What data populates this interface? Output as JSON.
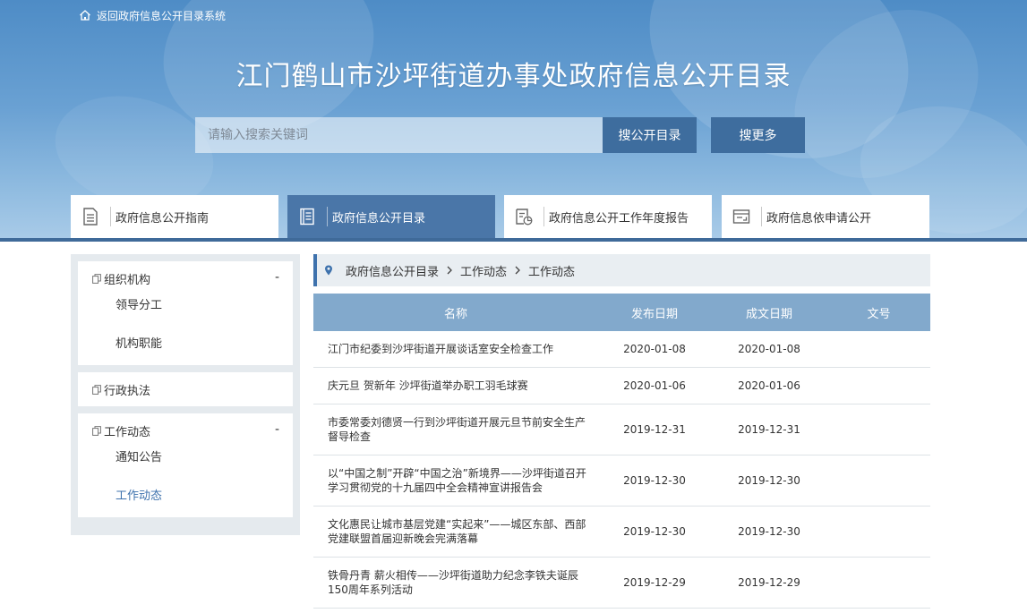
{
  "header": {
    "back_link": "返回政府信息公开目录系统",
    "title": "江门鹤山市沙坪街道办事处政府信息公开目录",
    "search_placeholder": "请输入搜索关键词",
    "search_catalog_button": "搜公开目录",
    "search_more_button": "搜更多"
  },
  "nav": {
    "tabs": [
      {
        "label": "政府信息公开指南",
        "icon": "document-lines-icon"
      },
      {
        "label": "政府信息公开目录",
        "icon": "catalog-book-icon",
        "active": true
      },
      {
        "label": "政府信息公开工作年度报告",
        "icon": "report-chart-icon"
      },
      {
        "label": "政府信息依申请公开",
        "icon": "application-form-icon"
      }
    ]
  },
  "sidebar": {
    "groups": [
      {
        "title": "组织机构",
        "toggle": "-",
        "items": [
          "领导分工",
          "机构职能"
        ]
      },
      {
        "title": "行政执法",
        "toggle": "",
        "items": []
      },
      {
        "title": "工作动态",
        "toggle": "-",
        "items": [
          "通知公告",
          "工作动态"
        ]
      }
    ]
  },
  "breadcrumb": [
    "政府信息公开目录",
    "工作动态",
    "工作动态"
  ],
  "table": {
    "headers": [
      "名称",
      "发布日期",
      "成文日期",
      "文号"
    ],
    "rows": [
      {
        "name": "江门市纪委到沙坪街道开展谈话室安全检查工作",
        "publish_date": "2020-01-08",
        "written_date": "2020-01-08",
        "doc_no": ""
      },
      {
        "name": "庆元旦 贺新年 沙坪街道举办职工羽毛球赛",
        "publish_date": "2020-01-06",
        "written_date": "2020-01-06",
        "doc_no": ""
      },
      {
        "name": "市委常委刘德贤一行到沙坪街道开展元旦节前安全生产督导检查",
        "publish_date": "2019-12-31",
        "written_date": "2019-12-31",
        "doc_no": ""
      },
      {
        "name": "以“中国之制”开辟“中国之治”新境界——沙坪街道召开学习贯彻党的十九届四中全会精神宣讲报告会",
        "publish_date": "2019-12-30",
        "written_date": "2019-12-30",
        "doc_no": ""
      },
      {
        "name": "文化惠民让城市基层党建“实起来”——城区东部、西部党建联盟首届迎新晚会完满落幕",
        "publish_date": "2019-12-30",
        "written_date": "2019-12-30",
        "doc_no": ""
      },
      {
        "name": "铁骨丹青 薪火相传——沙坪街道助力纪念李铁夫诞辰150周年系列活动",
        "publish_date": "2019-12-29",
        "written_date": "2019-12-29",
        "doc_no": ""
      }
    ]
  },
  "colors": {
    "nav_active": "#4a76a8",
    "button": "#3e6d9e",
    "table_header": "#82a9cc",
    "link_active": "#3e72ad"
  }
}
